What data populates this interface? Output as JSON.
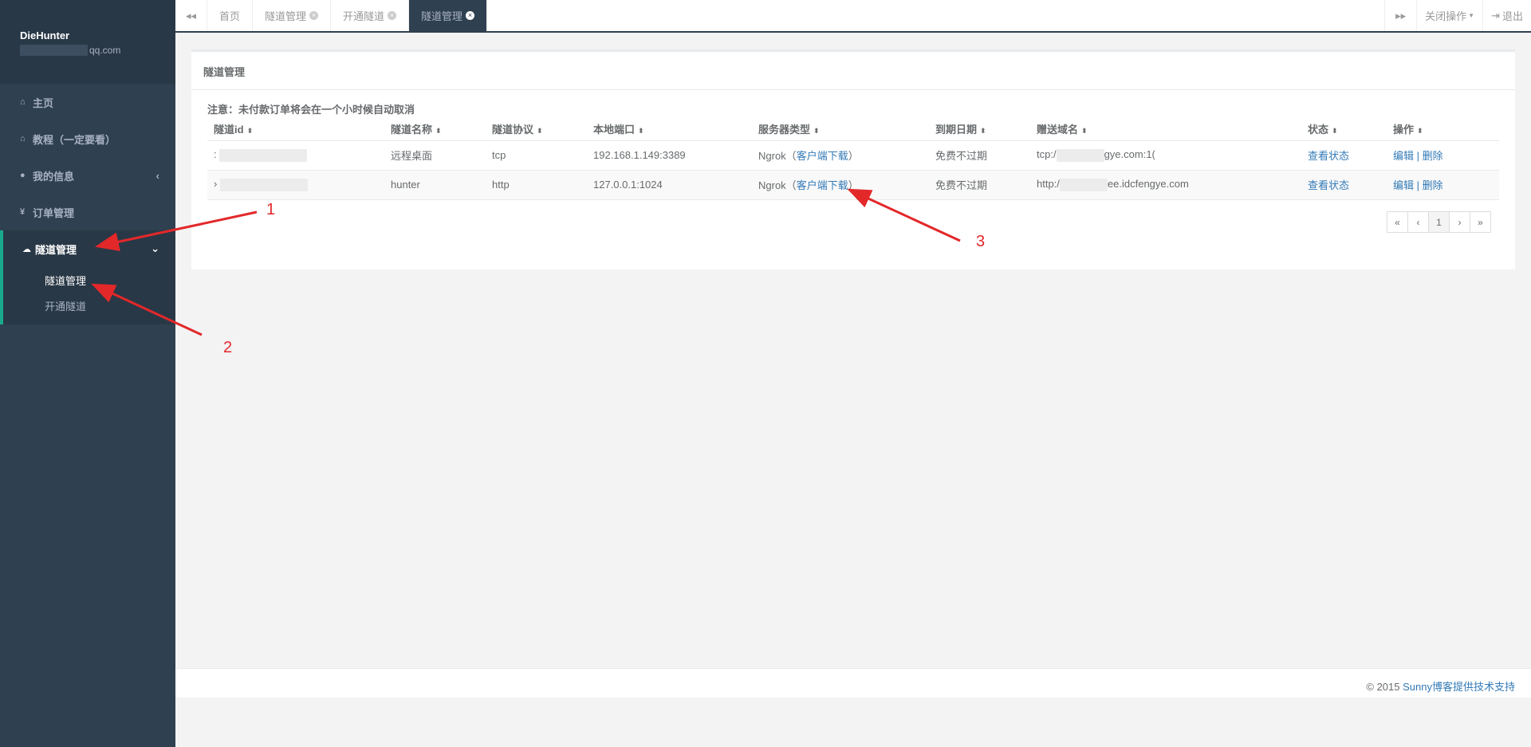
{
  "sidebar": {
    "username": "DieHunter",
    "email_suffix": "qq.com",
    "items": [
      {
        "label": "主页",
        "icon": "home-icon"
      },
      {
        "label": "教程（一定要看）",
        "icon": "home-icon"
      },
      {
        "label": "我的信息",
        "icon": "user-icon"
      },
      {
        "label": "订单管理",
        "icon": "yen-icon"
      }
    ],
    "group": {
      "label": "隧道管理",
      "icon": "cloud-icon",
      "subs": [
        "隧道管理",
        "开通隧道"
      ]
    }
  },
  "topbar": {
    "tabs": [
      {
        "label": "首页"
      },
      {
        "label": "隧道管理"
      },
      {
        "label": "开通隧道"
      },
      {
        "label": "隧道管理"
      }
    ],
    "close_ops": "关闭操作",
    "logout": "退出"
  },
  "panel": {
    "title": "隧道管理",
    "notice": "注意：未付款订单将会在一个小时候自动取消",
    "columns": [
      "隧道id",
      "隧道名称",
      "隧道协议",
      "本地端口",
      "服务器类型",
      "到期日期",
      "赠送域名",
      "状态",
      "操作"
    ],
    "rows": [
      {
        "id_prefix": ":",
        "name": "远程桌面",
        "protocol": "tcp",
        "port": "192.168.1.149:3389",
        "server": "Ngrok（",
        "download": "客户端下载",
        "server_end": "）",
        "expire": "免费不过期",
        "domain_prefix": "tcp:/",
        "domain_suffix": "gye.com:1(",
        "status": "查看状态",
        "edit": "编辑",
        "sep": "|",
        "delete": "删除"
      },
      {
        "id_prefix": "›",
        "name": "hunter",
        "protocol": "http",
        "port": "127.0.0.1:1024",
        "server": "Ngrok（",
        "download": "客户端下载",
        "server_end": "）",
        "expire": "免费不过期",
        "domain_prefix": "http:/",
        "domain_suffix": "ee.idcfengye.com",
        "status": "查看状态",
        "edit": "编辑",
        "sep": "|",
        "delete": "删除"
      }
    ],
    "pagination": [
      "«",
      "‹",
      "1",
      "›",
      "»"
    ]
  },
  "footer": {
    "copyright": "© 2015",
    "link": "Sunny博客提供技术支持"
  },
  "annotations": {
    "n1": "1",
    "n2": "2",
    "n3": "3",
    "color": "#e3282a"
  }
}
